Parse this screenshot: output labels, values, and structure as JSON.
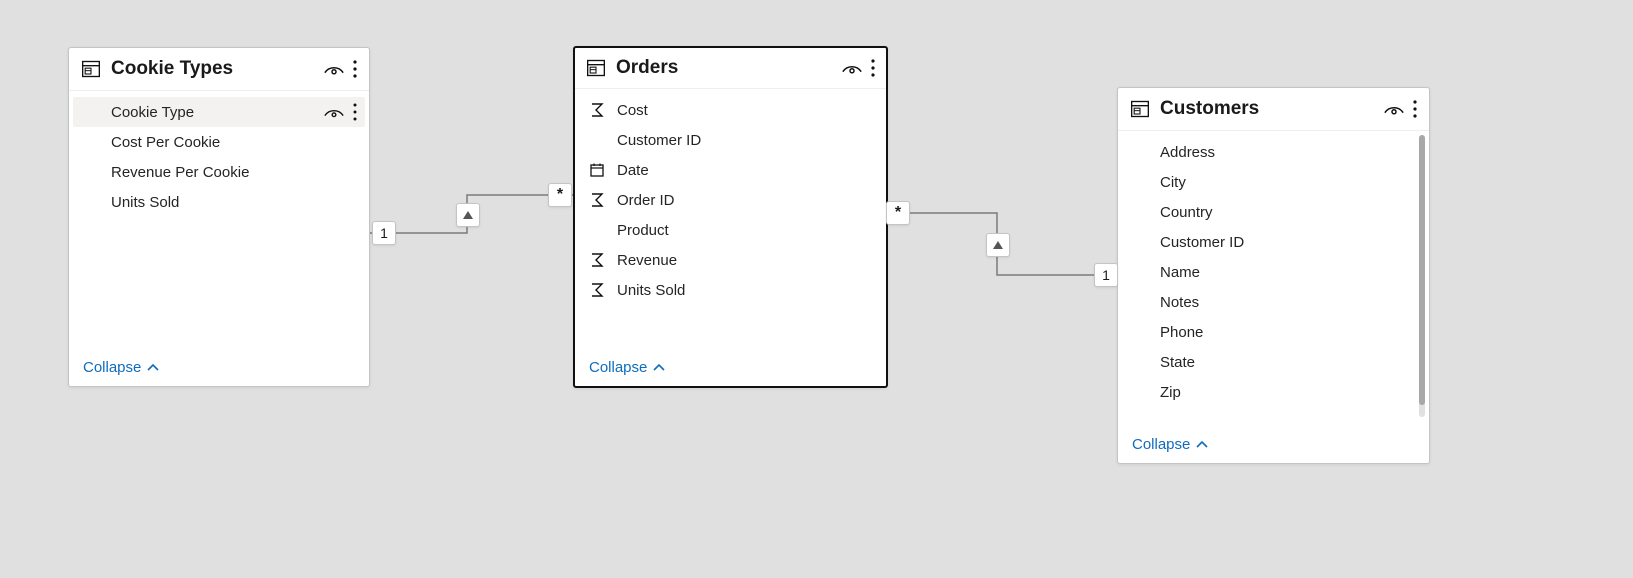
{
  "tables": {
    "cookieTypes": {
      "title": "Cookie Types",
      "fields": [
        {
          "label": "Cookie Type",
          "icon": "none",
          "highlight": true,
          "showActions": true
        },
        {
          "label": "Cost Per Cookie",
          "icon": "none"
        },
        {
          "label": "Revenue Per Cookie",
          "icon": "none"
        },
        {
          "label": "Units Sold",
          "icon": "none"
        }
      ],
      "collapse": "Collapse"
    },
    "orders": {
      "title": "Orders",
      "fields": [
        {
          "label": "Cost",
          "icon": "sum"
        },
        {
          "label": "Customer ID",
          "icon": "none"
        },
        {
          "label": "Date",
          "icon": "date"
        },
        {
          "label": "Order ID",
          "icon": "sum"
        },
        {
          "label": "Product",
          "icon": "none"
        },
        {
          "label": "Revenue",
          "icon": "sum"
        },
        {
          "label": "Units Sold",
          "icon": "sum"
        }
      ],
      "collapse": "Collapse"
    },
    "customers": {
      "title": "Customers",
      "fields": [
        {
          "label": "Address",
          "icon": "none"
        },
        {
          "label": "City",
          "icon": "none"
        },
        {
          "label": "Country",
          "icon": "none"
        },
        {
          "label": "Customer ID",
          "icon": "none"
        },
        {
          "label": "Name",
          "icon": "none"
        },
        {
          "label": "Notes",
          "icon": "none"
        },
        {
          "label": "Phone",
          "icon": "none"
        },
        {
          "label": "State",
          "icon": "none"
        },
        {
          "label": "Zip",
          "icon": "none"
        }
      ],
      "collapse": "Collapse"
    }
  },
  "relationships": {
    "cookieToOrders": {
      "leftCardinality": "1",
      "rightCardinality": "*"
    },
    "ordersToCustomers": {
      "leftCardinality": "*",
      "rightCardinality": "1"
    }
  }
}
